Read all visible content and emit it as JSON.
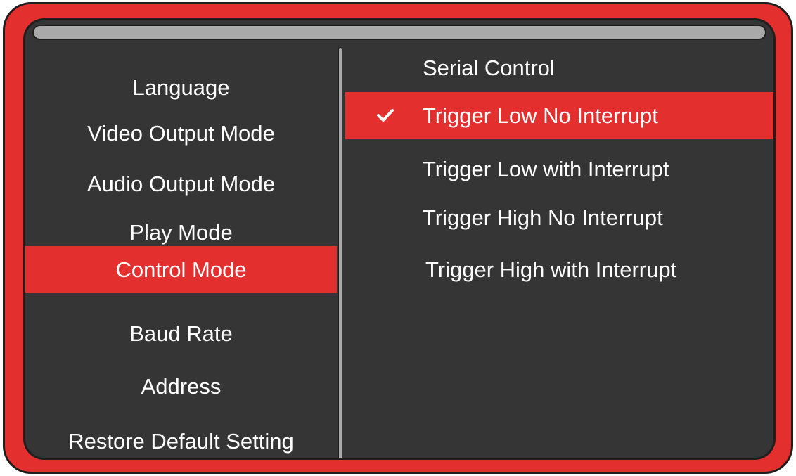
{
  "left_menu": {
    "items": [
      {
        "label": "Language"
      },
      {
        "label": "Video Output Mode"
      },
      {
        "label": "Audio Output Mode"
      },
      {
        "label": "Play Mode"
      },
      {
        "label": "Control Mode",
        "selected": true
      },
      {
        "label": "Baud Rate"
      },
      {
        "label": "Address"
      },
      {
        "label": "Restore Default Setting"
      }
    ]
  },
  "right_menu": {
    "options": [
      {
        "label": "Serial Control"
      },
      {
        "label": "Trigger Low No Interrupt",
        "selected": true,
        "checked": true
      },
      {
        "label": "Trigger Low with Interrupt"
      },
      {
        "label": "Trigger High No Interrupt"
      },
      {
        "label": "Trigger High with Interrupt"
      }
    ]
  },
  "icons": {
    "selected_option": "checkmark-icon"
  },
  "colors": {
    "accent": "#e3302f",
    "panel": "#353535",
    "frame": "#1e1e1e",
    "bar": "#a9a9a9",
    "text": "#ffffff"
  }
}
